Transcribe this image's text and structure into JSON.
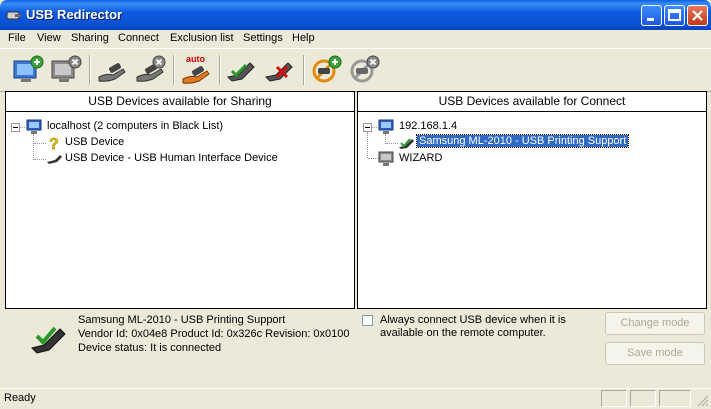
{
  "window": {
    "title": "USB Redirector"
  },
  "menu": [
    "File",
    "View",
    "Sharing",
    "Connect",
    "Exclusion list",
    "Settings",
    "Help"
  ],
  "toolbar": {
    "buttons": [
      {
        "icon": "add-computer-icon"
      },
      {
        "icon": "remove-computer-icon"
      },
      {
        "icon": "share-device-icon"
      },
      {
        "icon": "unshare-device-icon"
      },
      {
        "icon": "auto-share-icon",
        "label": "auto"
      },
      {
        "icon": "connect-device-icon"
      },
      {
        "icon": "disconnect-device-icon"
      },
      {
        "icon": "add-exclusion-icon"
      },
      {
        "icon": "remove-exclusion-icon"
      }
    ]
  },
  "sharing_panel": {
    "header": "USB Devices available for Sharing",
    "root": "localhost (2 computers in Black List)",
    "items": [
      "USB Device",
      "USB Device - USB Human Interface Device"
    ]
  },
  "connect_panel": {
    "header": "USB Devices available for Connect",
    "host1": "192.168.1.4",
    "host1_device": "Samsung ML-2010 - USB Printing Support",
    "host2": "WIZARD"
  },
  "details": {
    "device_name": "Samsung ML-2010 - USB Printing Support",
    "ids": "Vendor Id: 0x04e8 Product Id: 0x326c Revision: 0x0100",
    "status": "Device status: It is connected"
  },
  "options": {
    "always_connect": "Always connect USB device when it is available on the remote computer.",
    "always_connect_checked": false
  },
  "buttons": {
    "change_mode": "Change mode",
    "save_mode": "Save mode"
  },
  "statusbar": {
    "text": "Ready"
  },
  "colors": {
    "titlebar": "#0a5fe0",
    "selection": "#316ac5",
    "background": "#ece9d8"
  }
}
